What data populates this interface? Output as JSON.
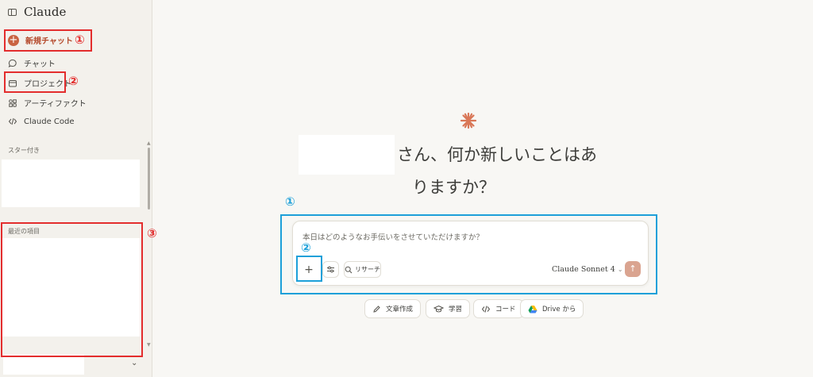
{
  "sidebar": {
    "app_title": "Claude",
    "new_chat": "新規チャット",
    "items": [
      {
        "label": "チャット",
        "icon": "chat-bubble-icon"
      },
      {
        "label": "プロジェクト",
        "icon": "folder-icon"
      },
      {
        "label": "アーティファクト",
        "icon": "artifacts-icon"
      },
      {
        "label": "Claude Code",
        "icon": "code-icon"
      }
    ],
    "starred_label": "スター付き",
    "recent_label": "最近の項目"
  },
  "main": {
    "greeting_line1": "さん、何か新しいことはあ",
    "greeting_line2": "りますか？",
    "input_placeholder": "本日はどのようなお手伝いをさせていただけますか？",
    "research_label": "リサーチ",
    "model_label": "Claude Sonnet 4",
    "chips": [
      {
        "label": "文章作成",
        "icon": "pencil-icon"
      },
      {
        "label": "学習",
        "icon": "graduation-cap-icon"
      },
      {
        "label": "コード",
        "icon": "code-icon"
      },
      {
        "label": "Drive から",
        "icon": "google-drive-icon"
      }
    ]
  },
  "annotations": {
    "circled_one": "①",
    "circled_two": "②",
    "circled_three": "③"
  },
  "colors": {
    "accent": "#c96442",
    "red_annotation": "#e32d2d",
    "blue_annotation": "#1da0d9",
    "send_button": "#daa490"
  }
}
